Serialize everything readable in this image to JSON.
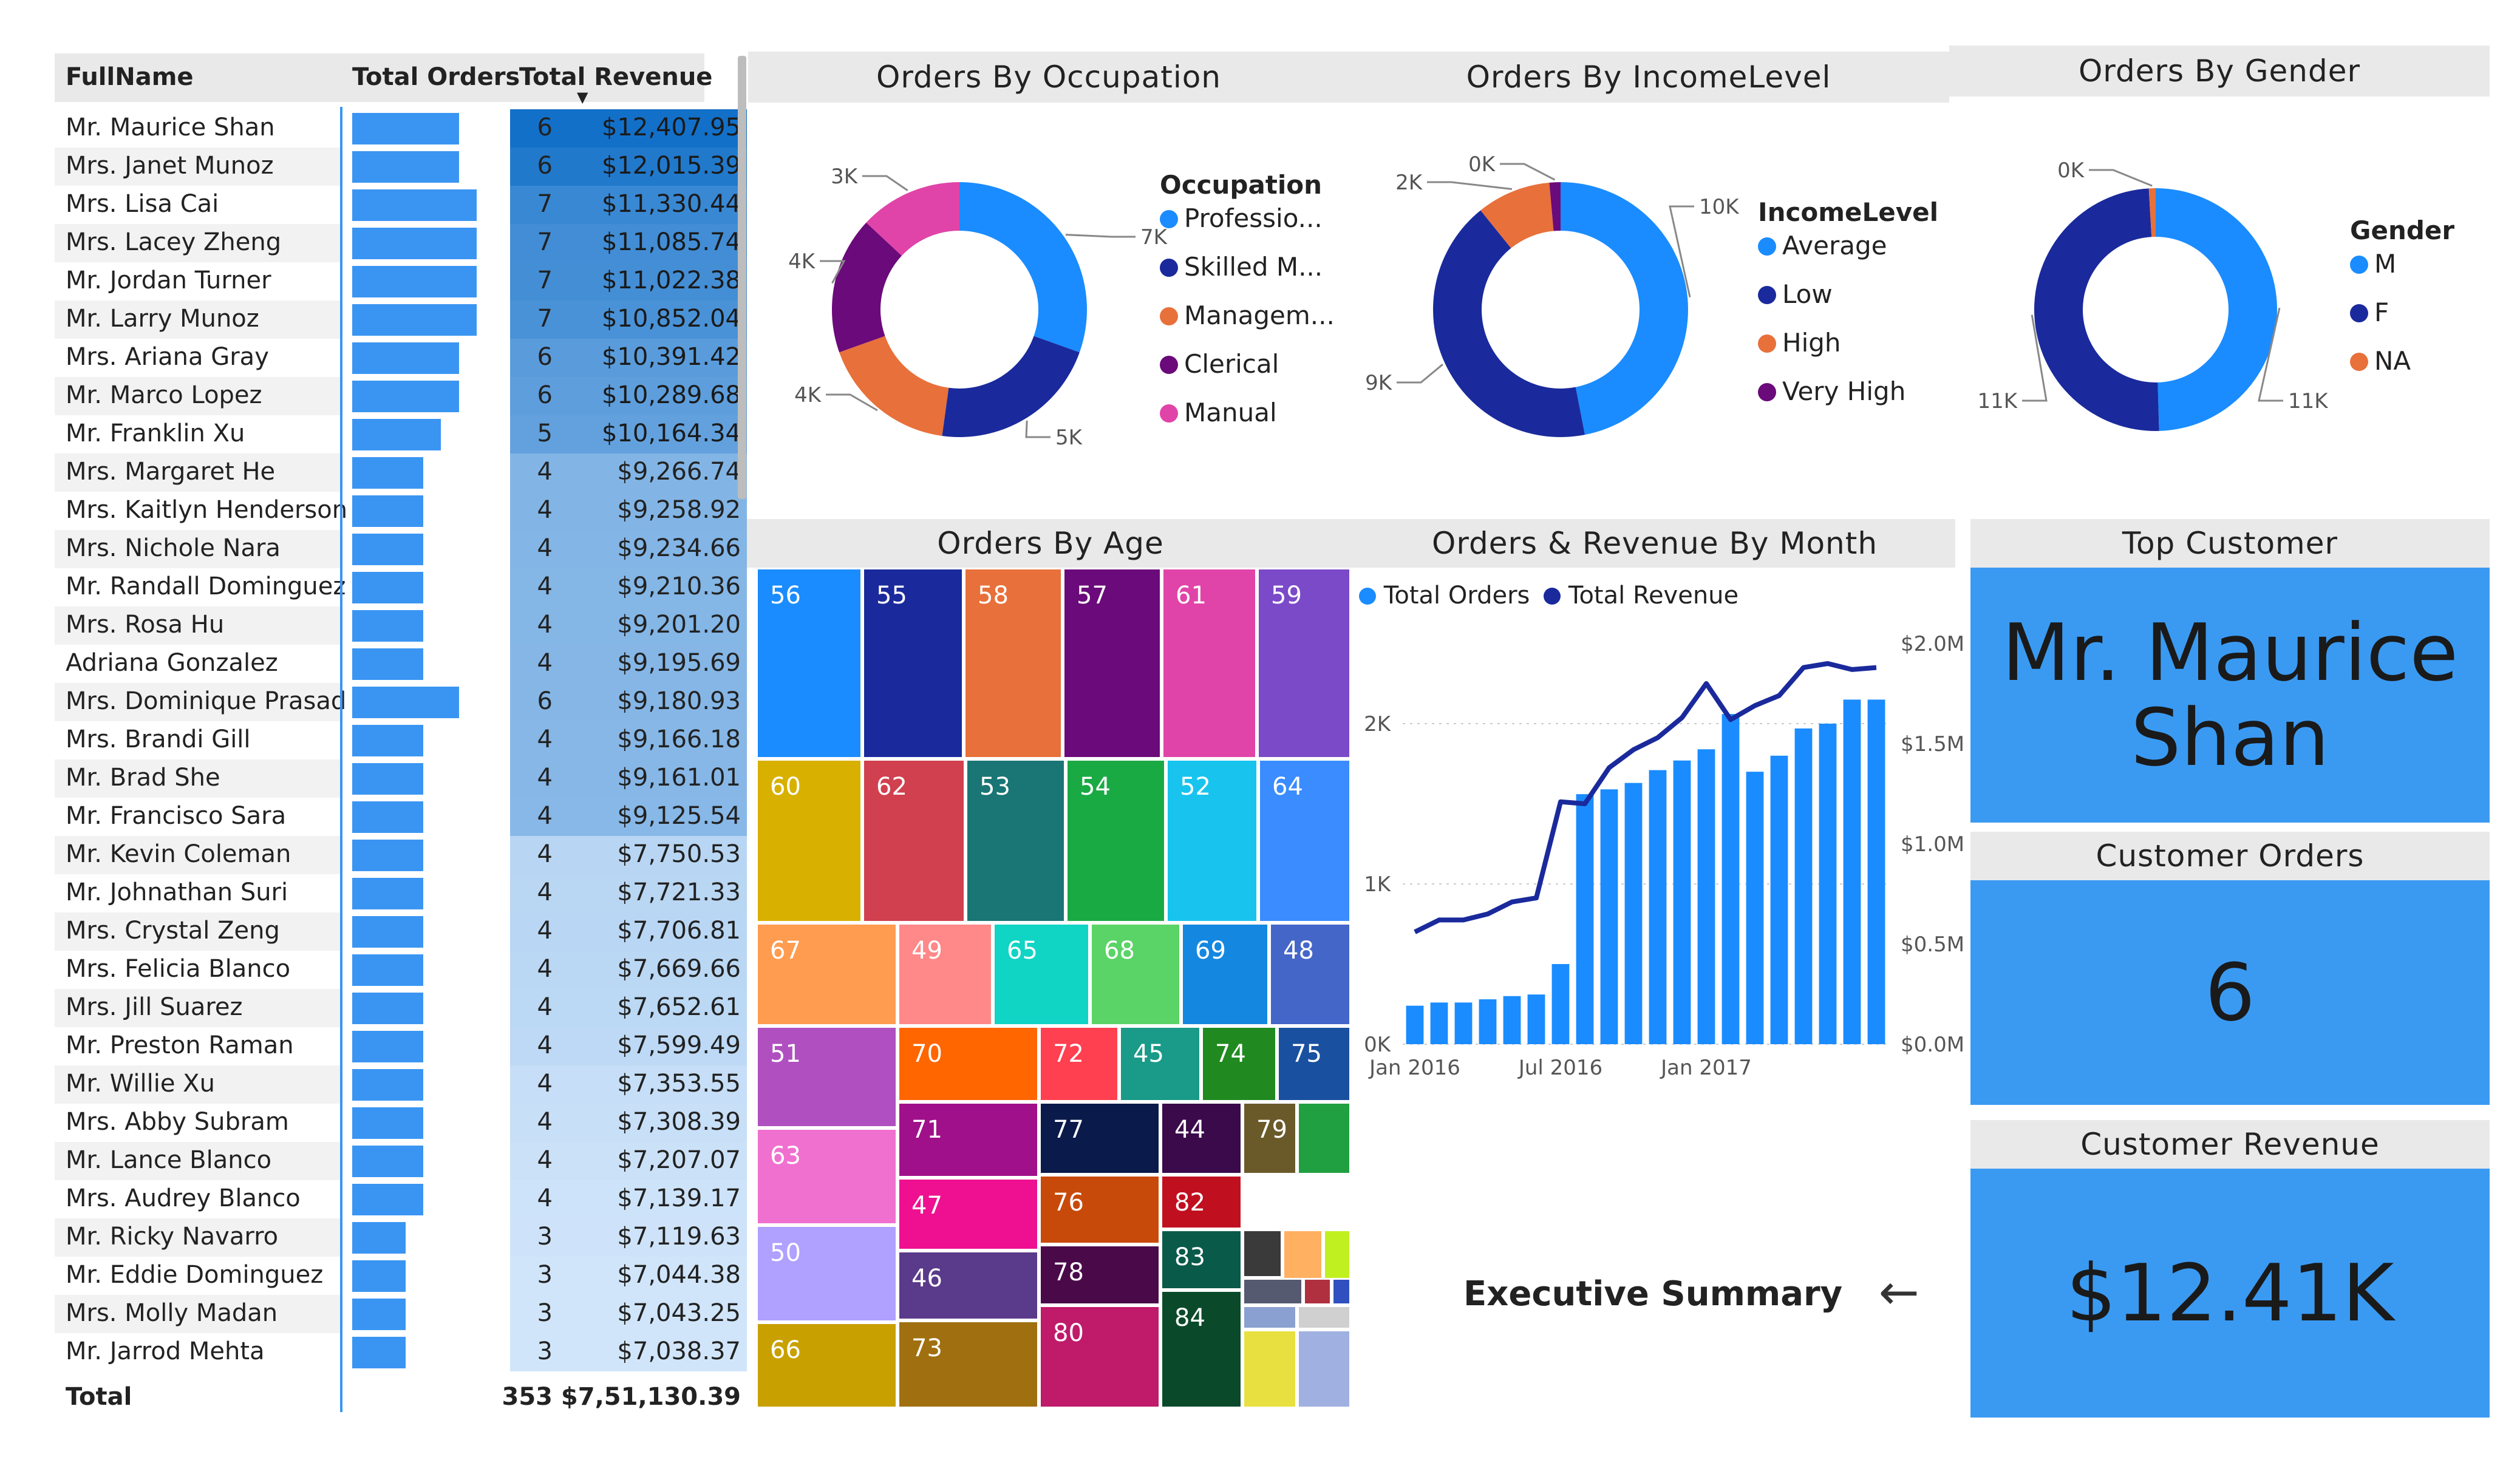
{
  "table": {
    "columns": [
      "FullName",
      "Total Orders",
      "Total Revenue"
    ],
    "rows": [
      {
        "name": "Mr. Maurice Shan",
        "orders": 6,
        "revenue": "$12,407.95",
        "rv": 12407.95
      },
      {
        "name": "Mrs. Janet Munoz",
        "orders": 6,
        "revenue": "$12,015.39",
        "rv": 12015.39
      },
      {
        "name": "Mrs. Lisa Cai",
        "orders": 7,
        "revenue": "$11,330.44",
        "rv": 11330.44
      },
      {
        "name": "Mrs. Lacey Zheng",
        "orders": 7,
        "revenue": "$11,085.74",
        "rv": 11085.74
      },
      {
        "name": "Mr. Jordan Turner",
        "orders": 7,
        "revenue": "$11,022.38",
        "rv": 11022.38
      },
      {
        "name": "Mr. Larry Munoz",
        "orders": 7,
        "revenue": "$10,852.04",
        "rv": 10852.04
      },
      {
        "name": "Mrs. Ariana Gray",
        "orders": 6,
        "revenue": "$10,391.42",
        "rv": 10391.42
      },
      {
        "name": "Mr. Marco Lopez",
        "orders": 6,
        "revenue": "$10,289.68",
        "rv": 10289.68
      },
      {
        "name": "Mr. Franklin Xu",
        "orders": 5,
        "revenue": "$10,164.34",
        "rv": 10164.34
      },
      {
        "name": "Mrs. Margaret He",
        "orders": 4,
        "revenue": "$9,266.74",
        "rv": 9266.74
      },
      {
        "name": "Mrs. Kaitlyn Henderson",
        "orders": 4,
        "revenue": "$9,258.92",
        "rv": 9258.92
      },
      {
        "name": "Mrs. Nichole Nara",
        "orders": 4,
        "revenue": "$9,234.66",
        "rv": 9234.66
      },
      {
        "name": "Mr. Randall Dominguez",
        "orders": 4,
        "revenue": "$9,210.36",
        "rv": 9210.36
      },
      {
        "name": "Mrs. Rosa Hu",
        "orders": 4,
        "revenue": "$9,201.20",
        "rv": 9201.2
      },
      {
        "name": "Adriana Gonzalez",
        "orders": 4,
        "revenue": "$9,195.69",
        "rv": 9195.69
      },
      {
        "name": "Mrs. Dominique Prasad",
        "orders": 6,
        "revenue": "$9,180.93",
        "rv": 9180.93
      },
      {
        "name": "Mrs. Brandi Gill",
        "orders": 4,
        "revenue": "$9,166.18",
        "rv": 9166.18
      },
      {
        "name": "Mr. Brad She",
        "orders": 4,
        "revenue": "$9,161.01",
        "rv": 9161.01
      },
      {
        "name": "Mr. Francisco Sara",
        "orders": 4,
        "revenue": "$9,125.54",
        "rv": 9125.54
      },
      {
        "name": "Mr. Kevin Coleman",
        "orders": 4,
        "revenue": "$7,750.53",
        "rv": 7750.53
      },
      {
        "name": "Mr. Johnathan Suri",
        "orders": 4,
        "revenue": "$7,721.33",
        "rv": 7721.33
      },
      {
        "name": "Mrs. Crystal Zeng",
        "orders": 4,
        "revenue": "$7,706.81",
        "rv": 7706.81
      },
      {
        "name": "Mrs. Felicia Blanco",
        "orders": 4,
        "revenue": "$7,669.66",
        "rv": 7669.66
      },
      {
        "name": "Mrs. Jill Suarez",
        "orders": 4,
        "revenue": "$7,652.61",
        "rv": 7652.61
      },
      {
        "name": "Mr. Preston Raman",
        "orders": 4,
        "revenue": "$7,599.49",
        "rv": 7599.49
      },
      {
        "name": "Mr. Willie Xu",
        "orders": 4,
        "revenue": "$7,353.55",
        "rv": 7353.55
      },
      {
        "name": "Mrs. Abby Subram",
        "orders": 4,
        "revenue": "$7,308.39",
        "rv": 7308.39
      },
      {
        "name": "Mr. Lance Blanco",
        "orders": 4,
        "revenue": "$7,207.07",
        "rv": 7207.07
      },
      {
        "name": "Mrs. Audrey Blanco",
        "orders": 4,
        "revenue": "$7,139.17",
        "rv": 7139.17
      },
      {
        "name": "Mr. Ricky Navarro",
        "orders": 3,
        "revenue": "$7,119.63",
        "rv": 7119.63
      },
      {
        "name": "Mr. Eddie Dominguez",
        "orders": 3,
        "revenue": "$7,044.38",
        "rv": 7044.38
      },
      {
        "name": "Mrs. Molly Madan",
        "orders": 3,
        "revenue": "$7,043.25",
        "rv": 7043.25
      },
      {
        "name": "Mr. Jarrod Mehta",
        "orders": 3,
        "revenue": "$7,038.37",
        "rv": 7038.37
      }
    ],
    "total": {
      "label": "Total",
      "orders": "353",
      "revenue": "$7,51,130.39"
    }
  },
  "chart_data": [
    {
      "type": "pie",
      "title": "Orders By Occupation",
      "legend_title": "Occupation",
      "categories": [
        "Professio...",
        "Skilled M...",
        "Managem...",
        "Clerical",
        "Manual"
      ],
      "values": [
        7,
        5,
        4,
        4,
        3
      ],
      "labels": [
        "7K",
        "5K",
        "4K",
        "4K",
        "3K"
      ],
      "colors": [
        "#1a8cff",
        "#1a2a9c",
        "#e8703a",
        "#6b0a7a",
        "#e044a8"
      ]
    },
    {
      "type": "pie",
      "title": "Orders By IncomeLevel",
      "legend_title": "IncomeLevel",
      "categories": [
        "Average",
        "Low",
        "High",
        "Very High"
      ],
      "values": [
        10,
        9,
        2,
        0.3
      ],
      "labels": [
        "10K",
        "9K",
        "2K",
        "0K"
      ],
      "colors": [
        "#1a8cff",
        "#1a2a9c",
        "#e8703a",
        "#6b0a7a"
      ]
    },
    {
      "type": "pie",
      "title": "Orders By Gender",
      "legend_title": "Gender",
      "categories": [
        "M",
        "F",
        "NA"
      ],
      "values": [
        11,
        11,
        0.2
      ],
      "labels": [
        "11K",
        "11K",
        "0K"
      ],
      "colors": [
        "#1a8cff",
        "#1a2a9c",
        "#e8703a"
      ]
    },
    {
      "type": "heatmap",
      "title": "Orders By Age",
      "cells": [
        {
          "label": "56",
          "color": "#1a8cff"
        },
        {
          "label": "55",
          "color": "#1a2a9c"
        },
        {
          "label": "58",
          "color": "#e8703a"
        },
        {
          "label": "57",
          "color": "#6b0a7a"
        },
        {
          "label": "61",
          "color": "#e044a8"
        },
        {
          "label": "59",
          "color": "#7b4ac8"
        },
        {
          "label": "60",
          "color": "#d8b000"
        },
        {
          "label": "62",
          "color": "#d0404e"
        },
        {
          "label": "53",
          "color": "#1a7575"
        },
        {
          "label": "54",
          "color": "#1aaa44"
        },
        {
          "label": "52",
          "color": "#18c4ee"
        },
        {
          "label": "64",
          "color": "#3a8cff"
        },
        {
          "label": "67",
          "color": "#ff9c50"
        },
        {
          "label": "49",
          "color": "#ff8888"
        },
        {
          "label": "65",
          "color": "#10d4c4"
        },
        {
          "label": "68",
          "color": "#5ad466"
        },
        {
          "label": "69",
          "color": "#1488e0"
        },
        {
          "label": "48",
          "color": "#4466c8"
        },
        {
          "label": "51",
          "color": "#b050c0"
        },
        {
          "label": "70",
          "color": "#ff6600"
        },
        {
          "label": "72",
          "color": "#ff4050"
        },
        {
          "label": "45",
          "color": "#1a9a88"
        },
        {
          "label": "74",
          "color": "#208a20"
        },
        {
          "label": "75",
          "color": "#1a50a0"
        },
        {
          "label": "63",
          "color": "#f070d0"
        },
        {
          "label": "71",
          "color": "#a0108a"
        },
        {
          "label": "77",
          "color": "#0a1a4a"
        },
        {
          "label": "44",
          "color": "#3a0a4a"
        },
        {
          "label": "79",
          "color": "#6a5a2a"
        },
        {
          "label": "",
          "color": "#20a040"
        },
        {
          "label": "50",
          "color": "#b0a0ff"
        },
        {
          "label": "47",
          "color": "#ee1090"
        },
        {
          "label": "76",
          "color": "#c84a0a"
        },
        {
          "label": "82",
          "color": "#c01020"
        },
        {
          "label": "66",
          "color": "#c8a000"
        },
        {
          "label": "46",
          "color": "#5a3a8a"
        },
        {
          "label": "78",
          "color": "#4a0a4a"
        },
        {
          "label": "83",
          "color": "#0a5a4a"
        },
        {
          "label": "73",
          "color": "#a07010"
        },
        {
          "label": "80",
          "color": "#c01a6a"
        },
        {
          "label": "84",
          "color": "#0a4a2a"
        }
      ]
    },
    {
      "type": "bar",
      "title": "Orders & Revenue By Month",
      "legend": [
        "Total Orders",
        "Total Revenue"
      ],
      "x_ticks": [
        "Jan 2016",
        "Jul 2016",
        "Jan 2017"
      ],
      "y_ticks": [
        "0K",
        "1K",
        "2K"
      ],
      "y2_ticks": [
        "$0.0M",
        "$0.5M",
        "$1.0M",
        "$1.5M",
        "$2.0M"
      ],
      "ylim": [
        0,
        2500
      ],
      "y2lim": [
        0,
        2000000
      ],
      "series": [
        {
          "name": "Total Orders",
          "values": [
            240,
            260,
            260,
            280,
            300,
            310,
            500,
            1560,
            1590,
            1630,
            1710,
            1770,
            1840,
            2060,
            1700,
            1800,
            1970,
            2000,
            2150,
            2150
          ]
        },
        {
          "name": "Total Revenue",
          "values": [
            560000,
            620000,
            620000,
            650000,
            710000,
            730000,
            1210000,
            1200000,
            1380000,
            1470000,
            1530000,
            1630000,
            1800000,
            1620000,
            1690000,
            1740000,
            1880000,
            1900000,
            1870000,
            1880000
          ]
        }
      ]
    }
  ],
  "nav": {
    "exec_label": "Executive Summary",
    "arrow": "←"
  },
  "top_customer": {
    "title": "Top Customer",
    "name_line1": "Mr. Maurice",
    "name_line2": "Shan"
  },
  "customer_orders": {
    "title": "Customer Orders",
    "value": "6"
  },
  "customer_revenue": {
    "title": "Customer Revenue",
    "value": "$12.41K"
  }
}
